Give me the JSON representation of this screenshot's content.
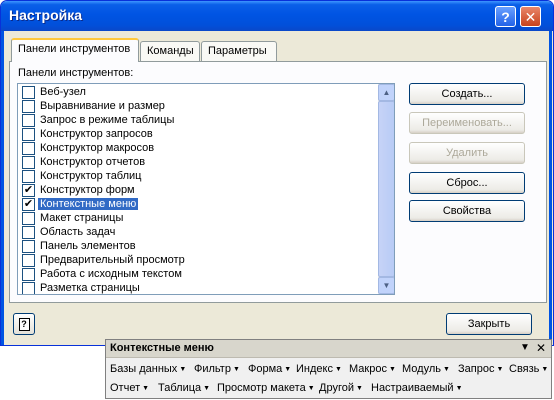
{
  "window": {
    "title": "Настройка"
  },
  "titlebar_buttons": {
    "help": "?",
    "close": "✕"
  },
  "tabs": [
    {
      "label": "Панели инструментов",
      "active": true
    },
    {
      "label": "Команды",
      "active": false
    },
    {
      "label": "Параметры",
      "active": false
    }
  ],
  "list_caption": "Панели инструментов:",
  "toolbars_list": [
    {
      "label": "Веб-узел",
      "checked": false,
      "selected": false
    },
    {
      "label": "Выравнивание и размер",
      "checked": false,
      "selected": false
    },
    {
      "label": "Запрос в режиме таблицы",
      "checked": false,
      "selected": false
    },
    {
      "label": "Конструктор запросов",
      "checked": false,
      "selected": false
    },
    {
      "label": "Конструктор макросов",
      "checked": false,
      "selected": false
    },
    {
      "label": "Конструктор отчетов",
      "checked": false,
      "selected": false
    },
    {
      "label": "Конструктор таблиц",
      "checked": false,
      "selected": false
    },
    {
      "label": "Конструктор форм",
      "checked": true,
      "selected": false
    },
    {
      "label": "Контекстные меню",
      "checked": true,
      "selected": true
    },
    {
      "label": "Макет страницы",
      "checked": false,
      "selected": false
    },
    {
      "label": "Область задач",
      "checked": false,
      "selected": false
    },
    {
      "label": "Панель элементов",
      "checked": false,
      "selected": false
    },
    {
      "label": "Предварительный просмотр",
      "checked": false,
      "selected": false
    },
    {
      "label": "Работа с исходным текстом",
      "checked": false,
      "selected": false
    },
    {
      "label": "Разметка страницы",
      "checked": false,
      "selected": false
    }
  ],
  "buttons": {
    "create": "Создать...",
    "rename": "Переименовать...",
    "delete": "Удалить",
    "reset": "Сброс...",
    "properties": "Свойства",
    "close": "Закрыть"
  },
  "help_button": "?",
  "floating_toolbar": {
    "title": "Контекстные меню",
    "row1": [
      "Базы данных",
      "Фильтр",
      "Форма",
      "Индекс",
      "Макрос",
      "Модуль",
      "Запрос",
      "Связь"
    ],
    "row2": [
      "Отчет",
      "Таблица",
      "Просмотр макета",
      "Другой",
      "Настраиваемый"
    ]
  },
  "colors": {
    "title_bar": "#0054e3",
    "selection": "#316ac5",
    "dialog_bg": "#ece9d8"
  }
}
